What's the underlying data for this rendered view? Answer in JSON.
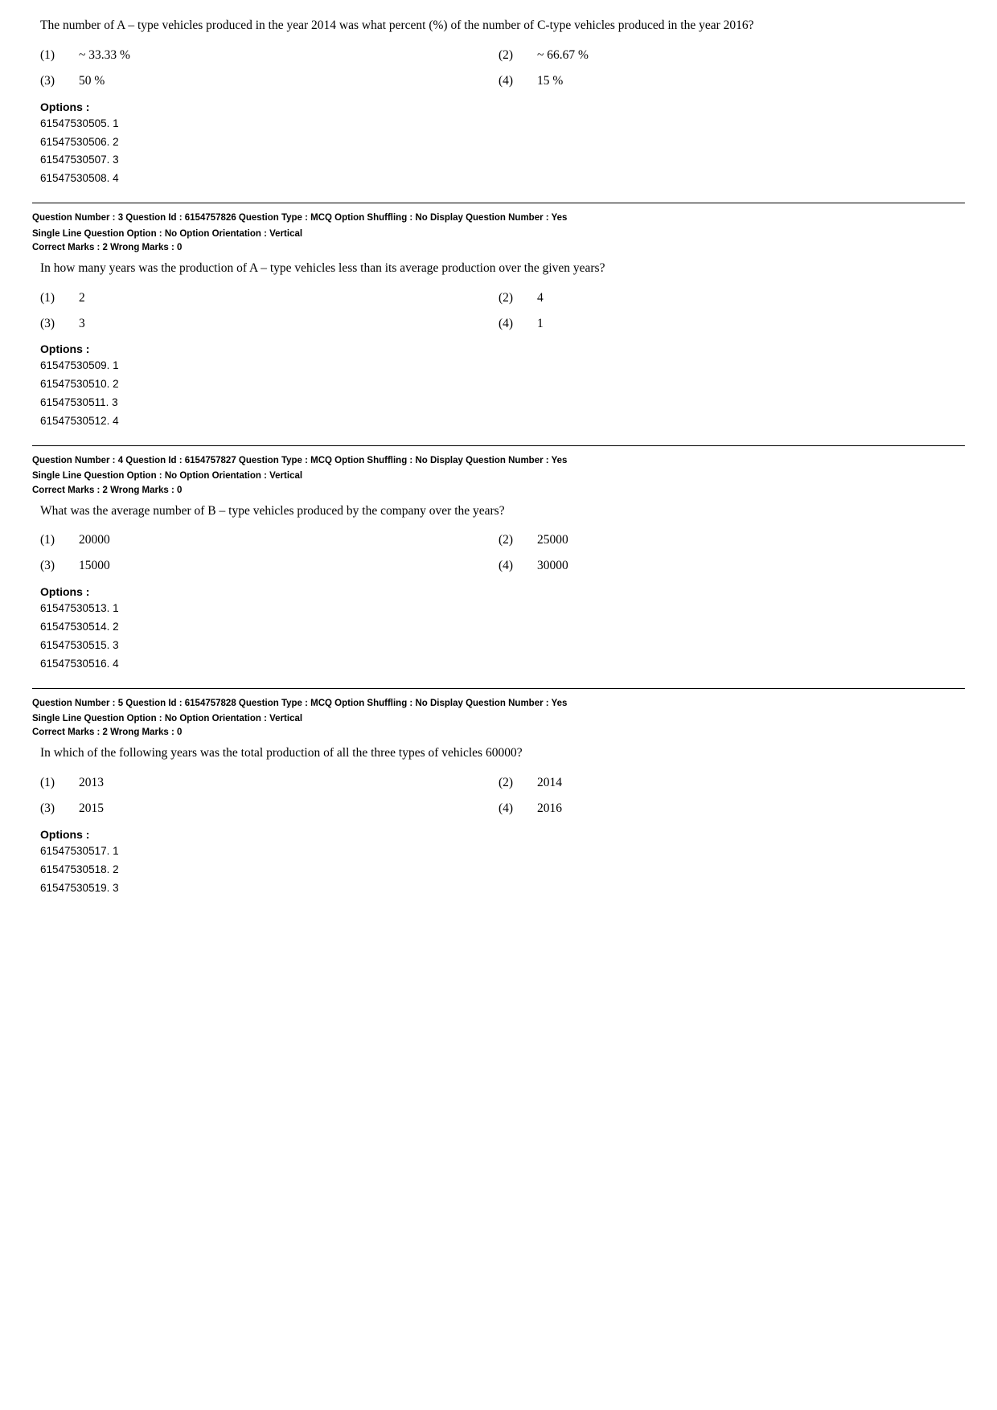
{
  "intro": {
    "text": "The number of A – type vehicles produced in the year 2014 was what percent (%) of the number of C-type vehicles produced in the year 2016?"
  },
  "q2": {
    "options": [
      {
        "num": "(1)",
        "val": "~ 33.33 %"
      },
      {
        "num": "(2)",
        "val": "~ 66.67 %"
      },
      {
        "num": "(3)",
        "val": "50 %"
      },
      {
        "num": "(4)",
        "val": "15 %"
      }
    ],
    "options_label": "Options :",
    "codes": [
      "61547530505. 1",
      "61547530506. 2",
      "61547530507. 3",
      "61547530508. 4"
    ]
  },
  "q3": {
    "meta_line1": "Question Number : 3  Question Id : 6154757826  Question Type : MCQ  Option Shuffling : No  Display Question Number : Yes",
    "meta_line2": "Single Line Question Option : No  Option Orientation : Vertical",
    "correct_marks": "Correct Marks : 2  Wrong Marks : 0",
    "text": "In how many years was the production of A – type vehicles less than its average production over the given years?",
    "options": [
      {
        "num": "(1)",
        "val": "2"
      },
      {
        "num": "(2)",
        "val": "4"
      },
      {
        "num": "(3)",
        "val": "3"
      },
      {
        "num": "(4)",
        "val": "1"
      }
    ],
    "options_label": "Options :",
    "codes": [
      "61547530509. 1",
      "61547530510. 2",
      "61547530511. 3",
      "61547530512. 4"
    ]
  },
  "q4": {
    "meta_line1": "Question Number : 4  Question Id : 6154757827  Question Type : MCQ  Option Shuffling : No  Display Question Number : Yes",
    "meta_line2": "Single Line Question Option : No  Option Orientation : Vertical",
    "correct_marks": "Correct Marks : 2  Wrong Marks : 0",
    "text": "What was the average number of B – type vehicles produced by the company over the years?",
    "options": [
      {
        "num": "(1)",
        "val": "20000"
      },
      {
        "num": "(2)",
        "val": "25000"
      },
      {
        "num": "(3)",
        "val": "15000"
      },
      {
        "num": "(4)",
        "val": "30000"
      }
    ],
    "options_label": "Options :",
    "codes": [
      "61547530513. 1",
      "61547530514. 2",
      "61547530515. 3",
      "61547530516. 4"
    ]
  },
  "q5": {
    "meta_line1": "Question Number : 5  Question Id : 6154757828  Question Type : MCQ  Option Shuffling : No  Display Question Number : Yes",
    "meta_line2": "Single Line Question Option : No  Option Orientation : Vertical",
    "correct_marks": "Correct Marks : 2  Wrong Marks : 0",
    "text": "In which of the following years was the total production of all the three types of vehicles 60000?",
    "options": [
      {
        "num": "(1)",
        "val": "2013"
      },
      {
        "num": "(2)",
        "val": "2014"
      },
      {
        "num": "(3)",
        "val": "2015"
      },
      {
        "num": "(4)",
        "val": "2016"
      }
    ],
    "options_label": "Options :",
    "codes": [
      "61547530517. 1",
      "61547530518. 2",
      "61547530519. 3"
    ]
  }
}
